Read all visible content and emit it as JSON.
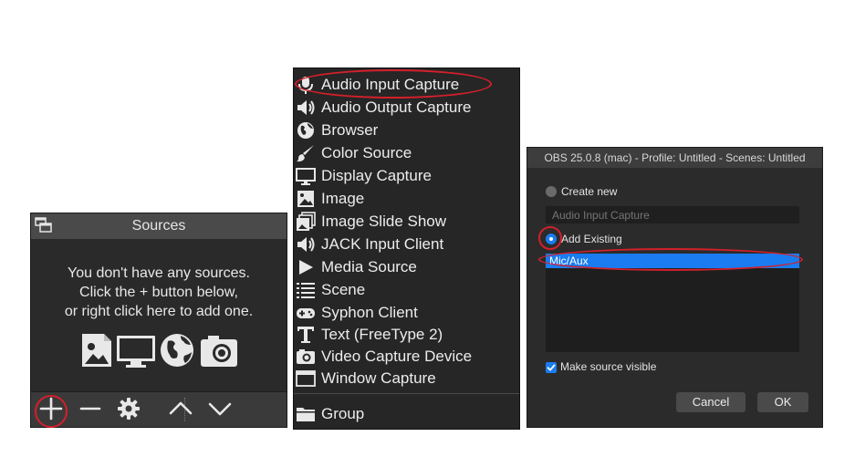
{
  "sources_panel": {
    "title": "Sources",
    "empty_lines": [
      "You don't have any sources.",
      "Click the + button below,",
      "or right click here to add one."
    ],
    "type_icons": [
      "image-icon",
      "display-icon",
      "globe-icon",
      "camera-icon"
    ],
    "toolbar": {
      "add": "plus-icon",
      "remove": "minus-icon",
      "properties": "gear-icon",
      "move_up": "chevron-up-icon",
      "move_down": "chevron-down-icon"
    }
  },
  "source_menu": {
    "items": [
      {
        "label": "Audio Input Capture",
        "icon": "microphone-icon"
      },
      {
        "label": "Audio Output Capture",
        "icon": "speaker-icon"
      },
      {
        "label": "Browser",
        "icon": "globe-icon"
      },
      {
        "label": "Color Source",
        "icon": "paintbrush-icon"
      },
      {
        "label": "Display Capture",
        "icon": "monitor-icon"
      },
      {
        "label": "Image",
        "icon": "image-icon"
      },
      {
        "label": "Image Slide Show",
        "icon": "slideshow-icon"
      },
      {
        "label": "JACK Input Client",
        "icon": "speaker-icon"
      },
      {
        "label": "Media Source",
        "icon": "play-icon"
      },
      {
        "label": "Scene",
        "icon": "list-icon"
      },
      {
        "label": "Syphon Client",
        "icon": "gamepad-icon"
      },
      {
        "label": "Text (FreeType 2)",
        "icon": "text-icon"
      },
      {
        "label": "Video Capture Device",
        "icon": "camera-icon"
      },
      {
        "label": "Window Capture",
        "icon": "window-icon"
      }
    ],
    "group": {
      "label": "Group",
      "icon": "folder-icon"
    }
  },
  "dialog": {
    "title": "OBS 25.0.8 (mac) - Profile: Untitled - Scenes: Untitled",
    "create_new_label": "Create new",
    "name_placeholder": "Audio Input Capture",
    "add_existing_label": "Add Existing",
    "existing_sources": [
      "Mic/Aux"
    ],
    "make_visible_label": "Make source visible",
    "make_visible_checked": true,
    "cancel_label": "Cancel",
    "ok_label": "OK"
  },
  "annotation_color": "#d3202b",
  "accent_color": "#1a7cf0"
}
